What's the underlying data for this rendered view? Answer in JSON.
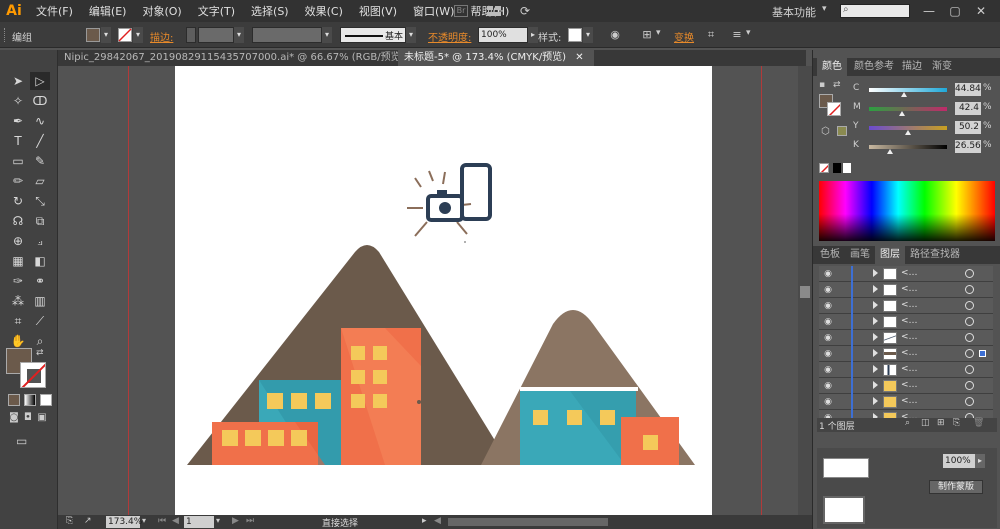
{
  "app": {
    "logo": "Ai",
    "menu": [
      "文件(F)",
      "编辑(E)",
      "对象(O)",
      "文字(T)",
      "选择(S)",
      "效果(C)",
      "视图(V)",
      "窗口(W)",
      "帮助(H)"
    ],
    "workspace": "基本功能",
    "window_controls": [
      "—",
      "▢",
      "✕"
    ]
  },
  "control_bar": {
    "selection_label": "编组",
    "stroke_label": "描边:",
    "stroke_style": "基本",
    "opacity_label": "不透明度:",
    "opacity_value": "100%",
    "style_label": "样式:",
    "transform_label": "变换",
    "fill_color": "#6b5a4b"
  },
  "tabs": [
    {
      "label": "Nipic_29842067_20190829115435707000.ai* @ 66.67% (RGB/预览)",
      "close": "✕"
    },
    {
      "label": "未标题-5* @ 173.4% (CMYK/预览)",
      "close": "✕"
    }
  ],
  "color_panel": {
    "tabs": [
      "颜色",
      "颜色参考",
      "描边",
      "渐变"
    ],
    "channels": [
      {
        "letter": "C",
        "value": "44.84",
        "fraction": 0.45,
        "gradient": [
          "#ffffff",
          "#1fa8d8"
        ]
      },
      {
        "letter": "M",
        "value": "42.4",
        "fraction": 0.42,
        "gradient": [
          "#2ba040",
          "#c02a6a"
        ]
      },
      {
        "letter": "Y",
        "value": "50.2",
        "fraction": 0.5,
        "gradient": [
          "#6b4bd0",
          "#c8a020"
        ]
      },
      {
        "letter": "K",
        "value": "26.56",
        "fraction": 0.27,
        "gradient": [
          "#c8b8a0",
          "#000000"
        ]
      }
    ],
    "percent": "%"
  },
  "layers_panel": {
    "tabs": [
      "色板",
      "画笔",
      "图层",
      "路径查找器"
    ],
    "rows": [
      "<…",
      "<…",
      "<…",
      "<…",
      "<…",
      "<…",
      "<…",
      "<…",
      "<…",
      "<…"
    ],
    "footer": "1 个图层"
  },
  "lower_panel": {
    "opacity_value": "100%",
    "make_mask_button": "制作蒙版"
  },
  "status_bar": {
    "zoom": "173.4%",
    "page": "1",
    "tool_name": "直接选择"
  },
  "colors": {
    "mountain_dark": "#6b5a4b",
    "mountain_light": "#8b7563",
    "orange": "#f0704a",
    "teal": "#3aa8b8",
    "window": "#f4c95a",
    "navy": "#2c3e55"
  }
}
